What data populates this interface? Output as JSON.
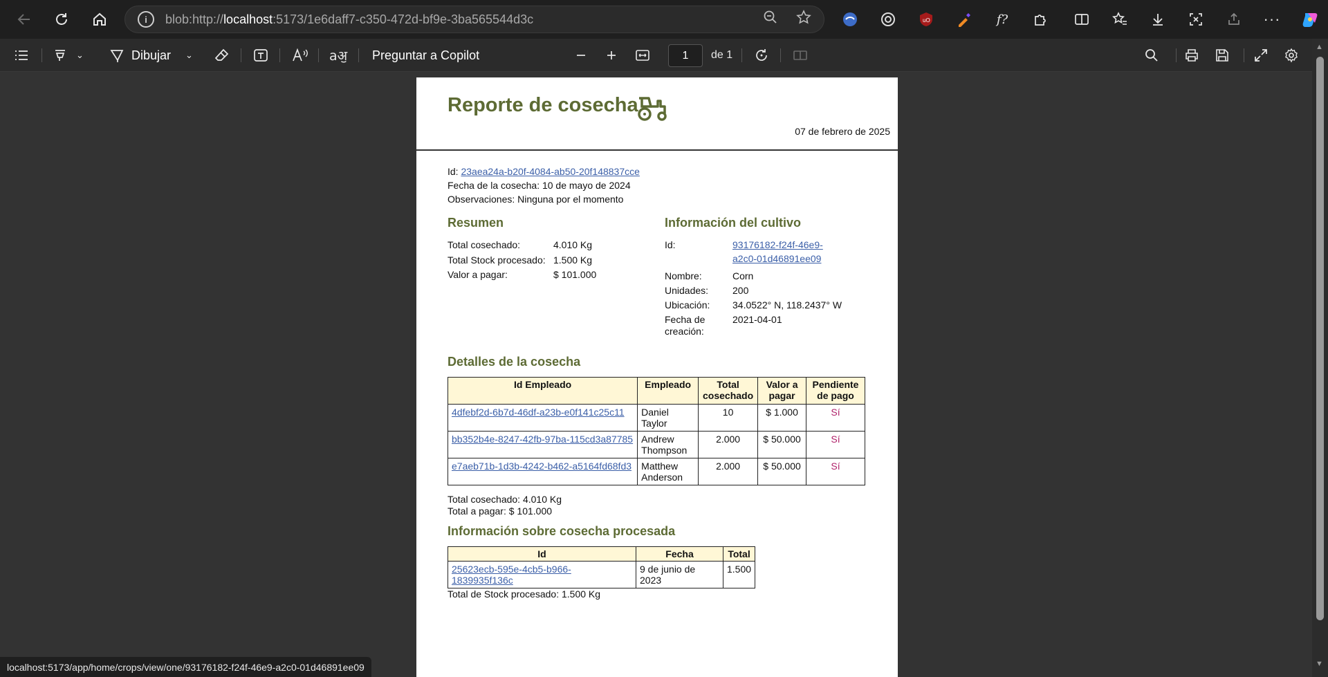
{
  "browser": {
    "url_prefix": "blob:http://",
    "url_host": "localhost",
    "url_rest": ":5173/1e6daff7-c350-472d-bf9e-3ba565544d3c"
  },
  "pdf_toolbar": {
    "draw_label": "Dibujar",
    "copilot_label": "Preguntar a Copilot",
    "page_number": "1",
    "page_total": "de 1"
  },
  "report": {
    "title": "Reporte de cosecha",
    "date": "07 de febrero de 2025",
    "id_label": "Id:",
    "id_value": "23aea24a-b20f-4084-ab50-20f148837cce",
    "harvest_date": "Fecha de la cosecha: 10 de mayo de 2024",
    "observations": "Observaciones: Ninguna por el momento"
  },
  "summary": {
    "heading": "Resumen",
    "rows": [
      {
        "label": "Total cosechado:",
        "value": "4.010 Kg"
      },
      {
        "label": "Total Stock procesado:",
        "value": "1.500 Kg"
      },
      {
        "label": "Valor a pagar:",
        "value": "$ 101.000"
      }
    ]
  },
  "crop": {
    "heading": "Información del cultivo",
    "id_label": "Id:",
    "id_line1": "93176182-f24f-46e9-",
    "id_line2": "a2c0-01d46891ee09",
    "name_label": "Nombre:",
    "name_value": "Corn",
    "units_label": "Unidades:",
    "units_value": "200",
    "location_label": "Ubicación:",
    "location_value": "34.0522° N, 118.2437° W",
    "created_label_1": "Fecha de",
    "created_label_2": "creación:",
    "created_value": "2021-04-01"
  },
  "details": {
    "heading": "Detalles de la cosecha",
    "headers": {
      "emp_id": "Id Empleado",
      "emp": "Empleado",
      "total_1": "Total",
      "total_2": "cosechado",
      "value_1": "Valor a",
      "value_2": "pagar",
      "pending_1": "Pendiente",
      "pending_2": "de pago"
    },
    "rows": [
      {
        "id": "4dfebf2d-6b7d-46df-a23b-e0f141c25c11",
        "first": "Daniel",
        "last": "Taylor",
        "total": "10",
        "value": "$ 1.000",
        "pending": "Sí"
      },
      {
        "id": "bb352b4e-8247-42fb-97ba-115cd3a87785",
        "first": "Andrew",
        "last": "Thompson",
        "total": "2.000",
        "value": "$ 50.000",
        "pending": "Sí"
      },
      {
        "id": "e7aeb71b-1d3b-4242-b462-a5164fd68fd3",
        "first": "Matthew",
        "last": "Anderson",
        "total": "2.000",
        "value": "$ 50.000",
        "pending": "Sí"
      }
    ],
    "total_harvested_label": "Total cosechado: ",
    "total_harvested_value": "4.010 Kg",
    "total_pay_label": "Total a pagar: ",
    "total_pay_value": "$ 101.000"
  },
  "processed": {
    "heading": "Información sobre cosecha procesada",
    "headers": {
      "id": "Id",
      "date": "Fecha",
      "total": "Total"
    },
    "rows": [
      {
        "id": "25623ecb-595e-4cb5-b966-1839935f136c",
        "date": "9 de junio de 2023",
        "total": "1.500"
      }
    ],
    "total_label": "Total de Stock procesado: ",
    "total_value": "1.500 Kg"
  },
  "status_bar": {
    "hover_url": "localhost:5173/app/home/crops/view/one/93176182-f24f-46e9-a2c0-01d46891ee09"
  }
}
